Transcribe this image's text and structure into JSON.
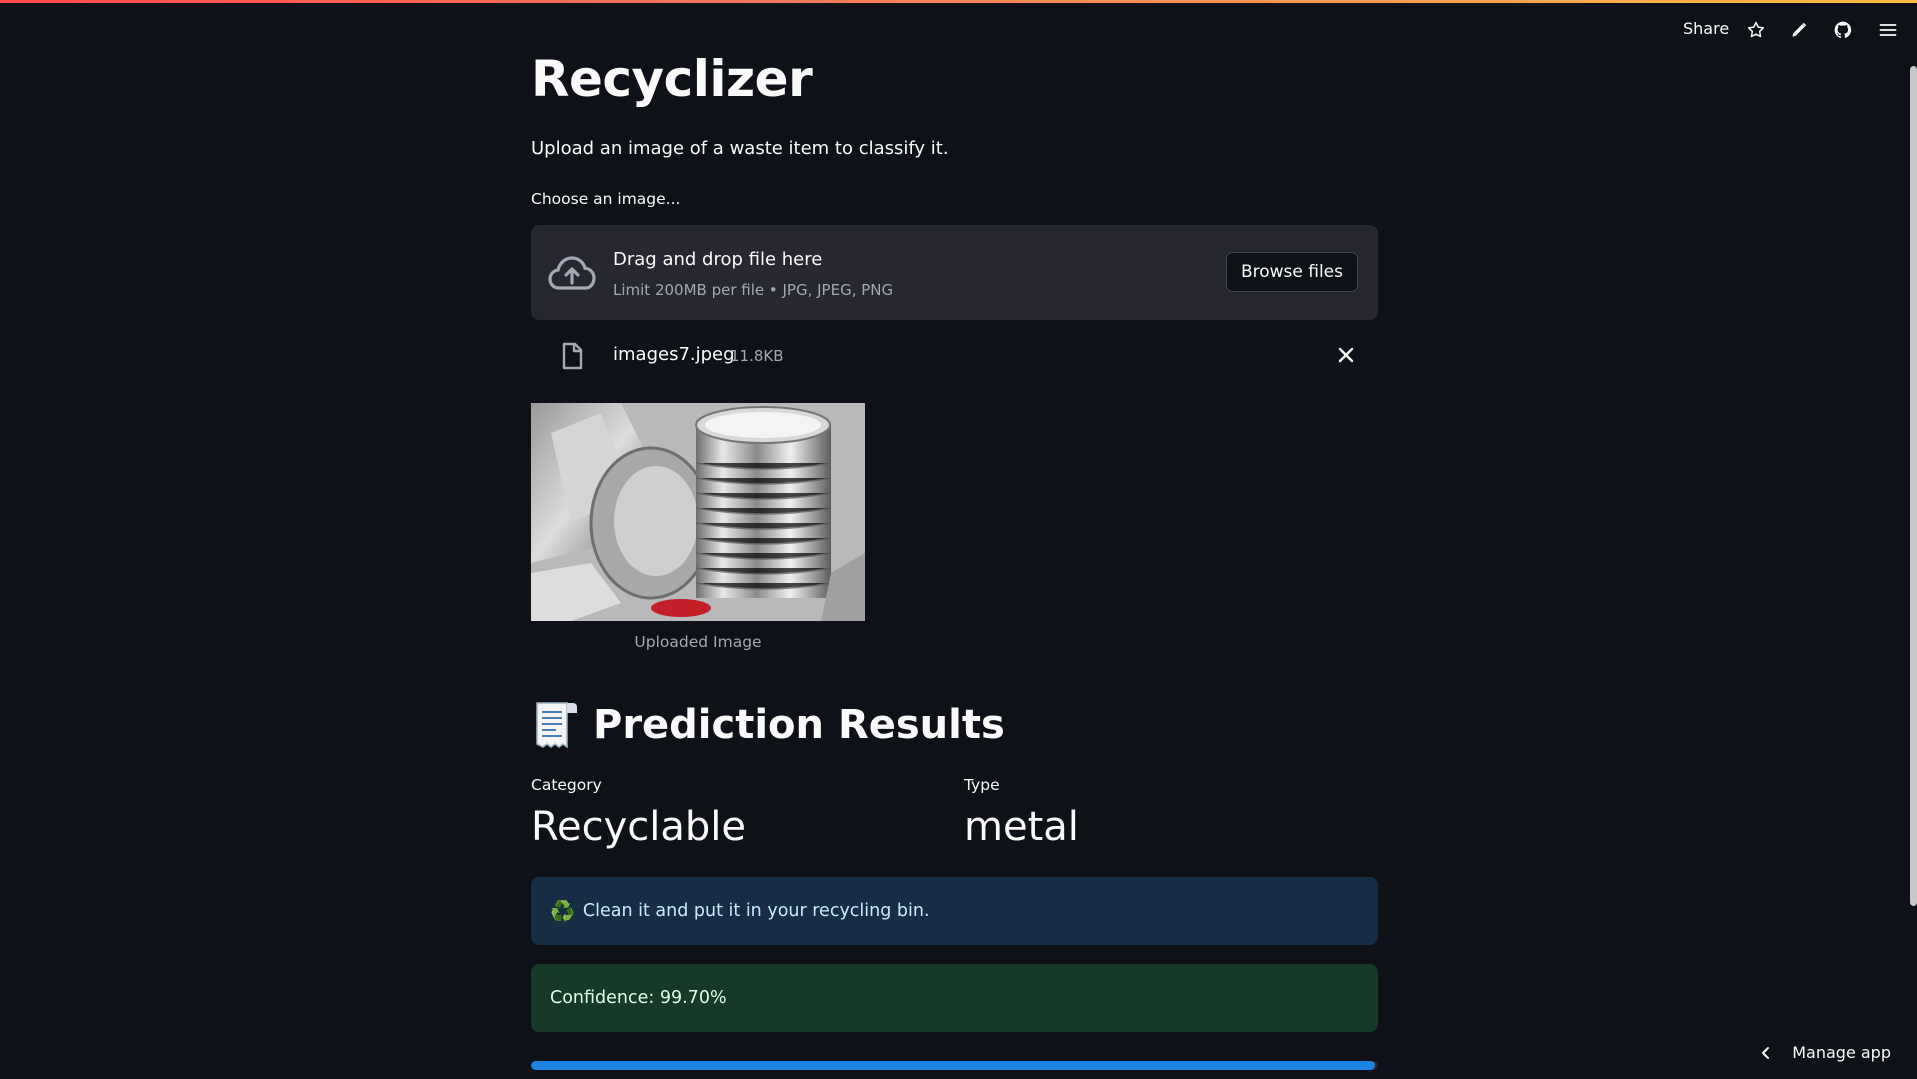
{
  "header": {
    "share_label": "Share",
    "icons": [
      "star-icon",
      "pencil-icon",
      "github-icon",
      "menu-icon"
    ]
  },
  "app": {
    "title": "Recyclizer",
    "subtitle": "Upload an image of a waste item to classify it."
  },
  "uploader": {
    "label": "Choose an image...",
    "drop_text": "Drag and drop file here",
    "limit_text": "Limit 200MB per file • JPG, JPEG, PNG",
    "browse_label": "Browse files",
    "file_name": "images7.jpeg",
    "file_size": "11.8KB"
  },
  "image": {
    "caption": "Uploaded Image"
  },
  "results": {
    "heading": "Prediction Results",
    "heading_emoji": "receipt",
    "category_label": "Category",
    "category_value": "Recyclable",
    "type_label": "Type",
    "type_value": "metal",
    "info_symbol": "♻️",
    "info_message": "Clean it and put it in your recycling bin.",
    "confidence_text": "Confidence: 99.70%",
    "confidence_value": 99.7
  },
  "footer": {
    "manage_label": "Manage app"
  },
  "colors": {
    "background": "#0e1117",
    "panel": "#262730",
    "accent_blue": "#1c83e1",
    "info_bg": "#172d43",
    "success_bg": "#173928"
  }
}
